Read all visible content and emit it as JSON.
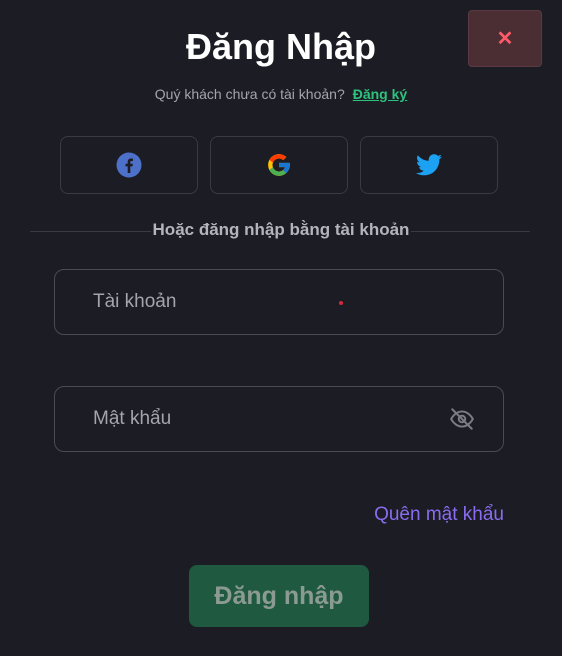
{
  "dialog": {
    "close_label": "✕",
    "title": "Đăng Nhập",
    "subtitle_prefix": "Quý khách chưa có tài khoản?",
    "signup_link": "Đăng ký"
  },
  "social": [
    {
      "name": "facebook",
      "icon": "facebook-icon",
      "color": "#4d71c9"
    },
    {
      "name": "google",
      "icon": "google-icon"
    },
    {
      "name": "twitter",
      "icon": "twitter-icon",
      "color": "#1da1f2"
    }
  ],
  "divider_text": "Hoặc đăng nhập bằng tài khoản",
  "form": {
    "username_placeholder": "Tài khoản",
    "username_value": "",
    "password_placeholder": "Mật khẩu",
    "password_value": "",
    "forgot_link": "Quên mật khẩu",
    "submit_label": "Đăng nhập"
  },
  "colors": {
    "background": "#1c1c24",
    "accent_green": "#2ec27e",
    "link_purple": "#8a6cf0",
    "close_red": "#ff5a6a"
  }
}
